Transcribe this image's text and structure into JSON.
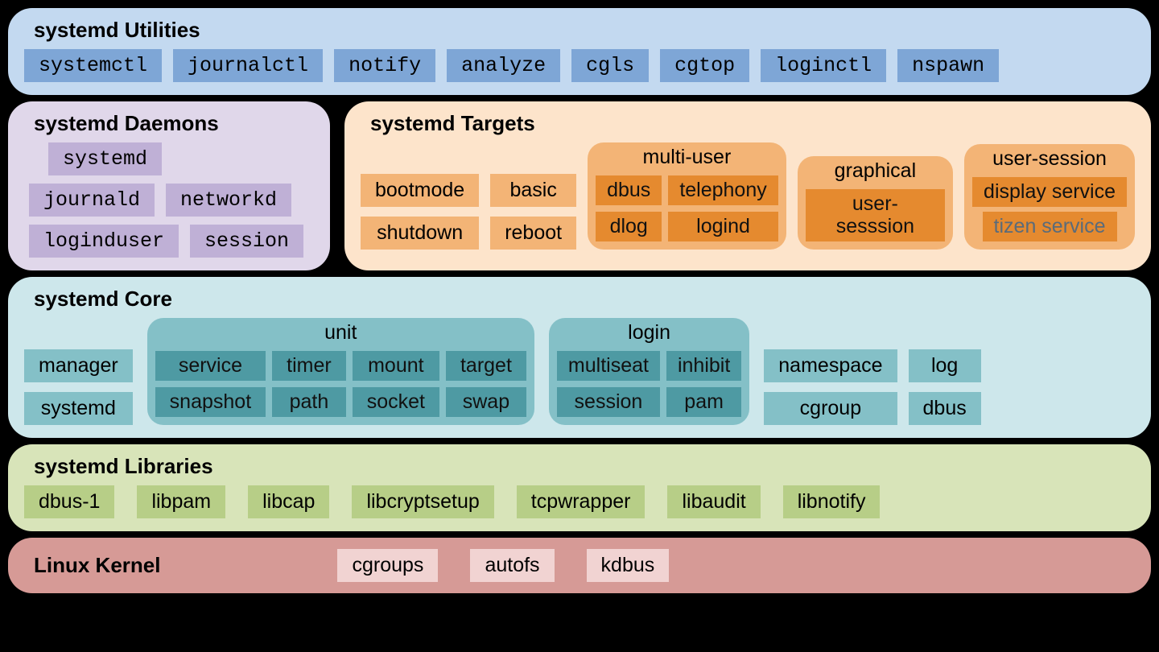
{
  "utilities": {
    "title": "systemd Utilities",
    "items": [
      "systemctl",
      "journalctl",
      "notify",
      "analyze",
      "cgls",
      "cgtop",
      "loginctl",
      "nspawn"
    ]
  },
  "daemons": {
    "title": "systemd Daemons",
    "row0": [
      "systemd"
    ],
    "row1": [
      "journald",
      "networkd"
    ],
    "row2": [
      "loginduser",
      "session"
    ]
  },
  "targets": {
    "title": "systemd Targets",
    "simple": [
      "bootmode",
      "basic",
      "shutdown",
      "reboot"
    ],
    "multi_user": {
      "title": "multi-user",
      "items": [
        "dbus",
        "telephony",
        "dlog",
        "logind"
      ]
    },
    "graphical": {
      "title": "graphical",
      "items": [
        "user-sesssion"
      ]
    },
    "user_session": {
      "title": "user-session",
      "items": [
        {
          "label": "display service",
          "muted": false
        },
        {
          "label": "tizen service",
          "muted": true
        }
      ]
    }
  },
  "core": {
    "title": "systemd Core",
    "left": [
      "manager",
      "systemd"
    ],
    "unit": {
      "title": "unit",
      "items": [
        "service",
        "timer",
        "mount",
        "target",
        "snapshot",
        "path",
        "socket",
        "swap"
      ]
    },
    "login": {
      "title": "login",
      "items": [
        "multiseat",
        "inhibit",
        "session",
        "pam"
      ]
    },
    "right": [
      "namespace",
      "log",
      "cgroup",
      "dbus"
    ]
  },
  "libraries": {
    "title": "systemd Libraries",
    "items": [
      "dbus-1",
      "libpam",
      "libcap",
      "libcryptsetup",
      "tcpwrapper",
      "libaudit",
      "libnotify"
    ]
  },
  "kernel": {
    "title": "Linux Kernel",
    "items": [
      "cgroups",
      "autofs",
      "kdbus"
    ]
  }
}
